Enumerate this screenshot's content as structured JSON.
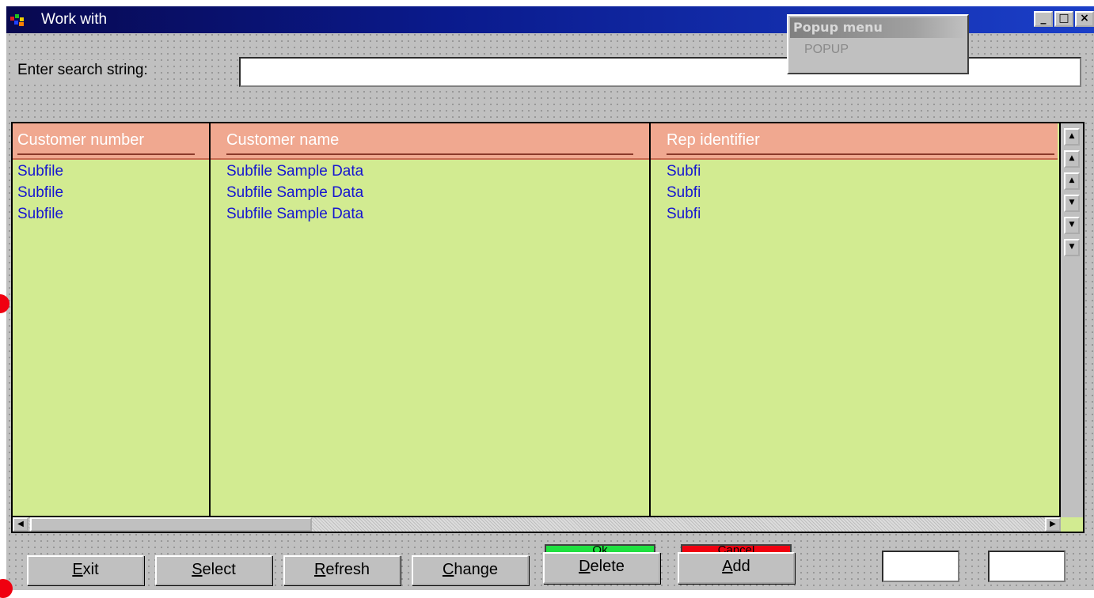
{
  "window": {
    "title": "Work with",
    "controls": [
      "_",
      "□",
      "×"
    ]
  },
  "search": {
    "label": "Enter search string:",
    "value": ""
  },
  "popup_menu": {
    "title": "Popup menu",
    "item": "POPUP"
  },
  "grid": {
    "columns": [
      "Customer number",
      "Customer name",
      "Rep identifier"
    ],
    "rows": [
      [
        "Subfile",
        "Subfile Sample Data",
        "Subfi"
      ],
      [
        "Subfile",
        "Subfile Sample Data",
        "Subfi"
      ],
      [
        "Subfile",
        "Subfile Sample Data",
        "Subfi"
      ]
    ],
    "header_color": "#f0a890",
    "body_color": "#d2eb91",
    "text_color": "#1515d0"
  },
  "buttons": {
    "exit": {
      "pre": "",
      "key": "E",
      "post": "xit"
    },
    "select": {
      "pre": "",
      "key": "S",
      "post": "elect"
    },
    "refresh": {
      "pre": "",
      "key": "R",
      "post": "efresh"
    },
    "change": {
      "pre": "",
      "key": "C",
      "post": "hange"
    },
    "delete": {
      "pre": "",
      "key": "D",
      "post": "elete"
    },
    "add": {
      "pre": "",
      "key": "A",
      "post": "dd"
    }
  },
  "status_bars": {
    "ok": {
      "label": "Ok",
      "color": "#20e040"
    },
    "cancel": {
      "label": "Cancel",
      "color": "#f00010"
    }
  }
}
